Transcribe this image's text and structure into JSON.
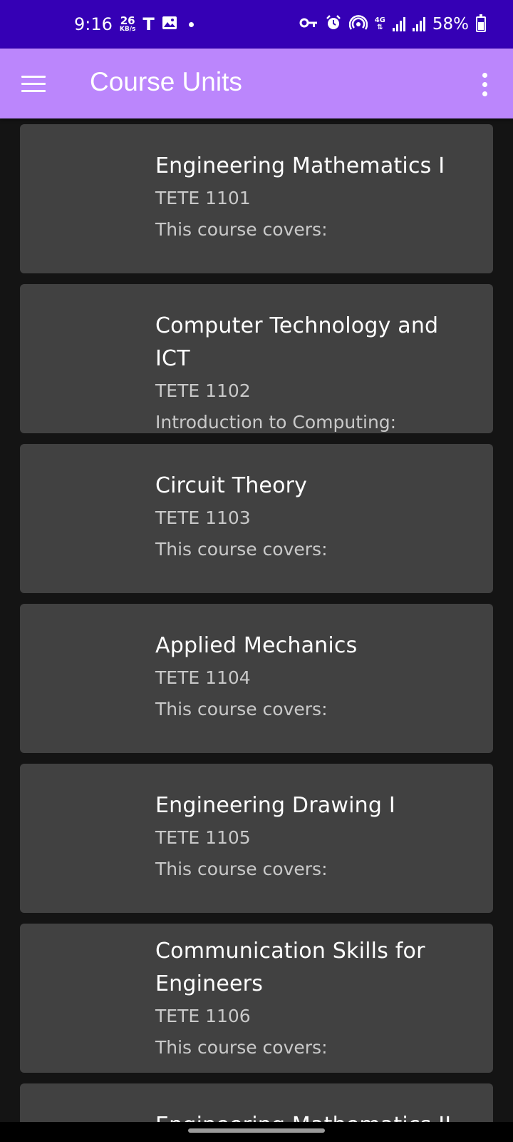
{
  "status_bar": {
    "time": "9:16",
    "speed_value": "26",
    "speed_unit": "KB/s",
    "carrier_glyph": "T",
    "network": "4G",
    "battery": "58%",
    "icons": [
      "gallery-icon",
      "vpn-key-icon",
      "alarm-icon",
      "hotspot-icon",
      "signal-icon",
      "battery-charging-icon"
    ]
  },
  "app_bar": {
    "title": "Course Units",
    "background": "#bb86fc"
  },
  "courses": [
    {
      "title": "Engineering Mathematics I",
      "code": "TETE 1101",
      "description": "This course covers:"
    },
    {
      "title": "Computer Technology and ICT",
      "code": "TETE 1102",
      "description": "Introduction to Computing:"
    },
    {
      "title": "Circuit Theory",
      "code": "TETE 1103",
      "description": "This course covers:"
    },
    {
      "title": "Applied Mechanics",
      "code": "TETE 1104",
      "description": "This course covers:"
    },
    {
      "title": "Engineering Drawing I",
      "code": "TETE 1105",
      "description": "This course covers:"
    },
    {
      "title": "Communication Skills for Engineers",
      "code": "TETE 1106",
      "description": "This course covers:"
    },
    {
      "title": "Engineering Mathematics II"
    }
  ]
}
